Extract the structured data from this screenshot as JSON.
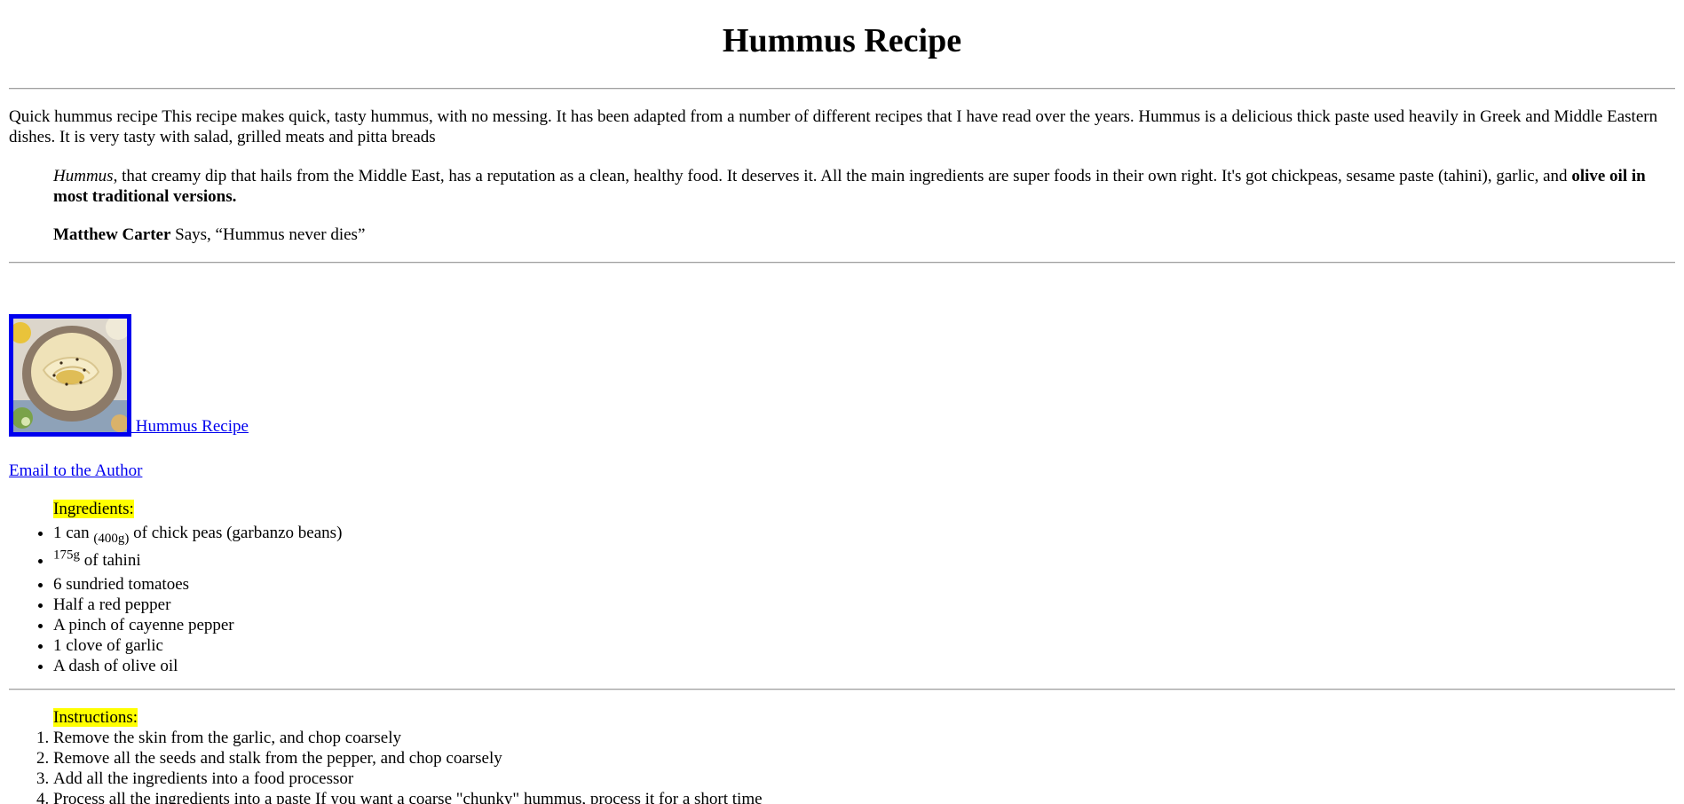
{
  "title": "Hummus Recipe",
  "intro": "Quick hummus recipe This recipe makes quick, tasty hummus, with no messing. It has been adapted from a number of different recipes that I have read over the years. Hummus is a delicious thick paste used heavily in Greek and Middle Eastern dishes. It is very tasty with salad, grilled meats and pitta breads",
  "quote": {
    "em": "Hummus",
    "text": ", that creamy dip that hails from the Middle East, has a reputation as a clean, healthy food. It deserves it. All the main ingredients are super foods in their own right. It's got chickpeas, sesame paste (tahini), garlic, and ",
    "bold": "olive oil in most traditional versions."
  },
  "says": {
    "author": "Matthew Carter",
    "text": " Says, “Hummus never dies”"
  },
  "photo_link": {
    "label": " Hummus Recipe"
  },
  "email_link": {
    "label": "Email to the Author"
  },
  "ingredients": {
    "heading": "Ingredients:",
    "items": [
      {
        "before": "1 can ",
        "small": "(400g)",
        "after": " of chick peas (garbanzo beans)"
      },
      {
        "before": "",
        "small": "175g",
        "after": " of tahini"
      },
      {
        "text": "6 sundried tomatoes"
      },
      {
        "text": "Half a red pepper"
      },
      {
        "text": "A pinch of cayenne pepper"
      },
      {
        "text": "1 clove of garlic"
      },
      {
        "text": "A dash of olive oil"
      }
    ]
  },
  "instructions": {
    "heading": "Instructions:",
    "items": [
      "Remove the skin from the garlic, and chop coarsely",
      "Remove all the seeds and stalk from the pepper, and chop coarsely",
      "Add all the ingredients into a food processor",
      "Process all the ingredients into a paste If you want a coarse \"chunky\" hummus, process it for a short time"
    ]
  },
  "colors": {
    "link": "#0000ee",
    "highlight": "#ffff00",
    "rule": "#a0a0a0"
  }
}
